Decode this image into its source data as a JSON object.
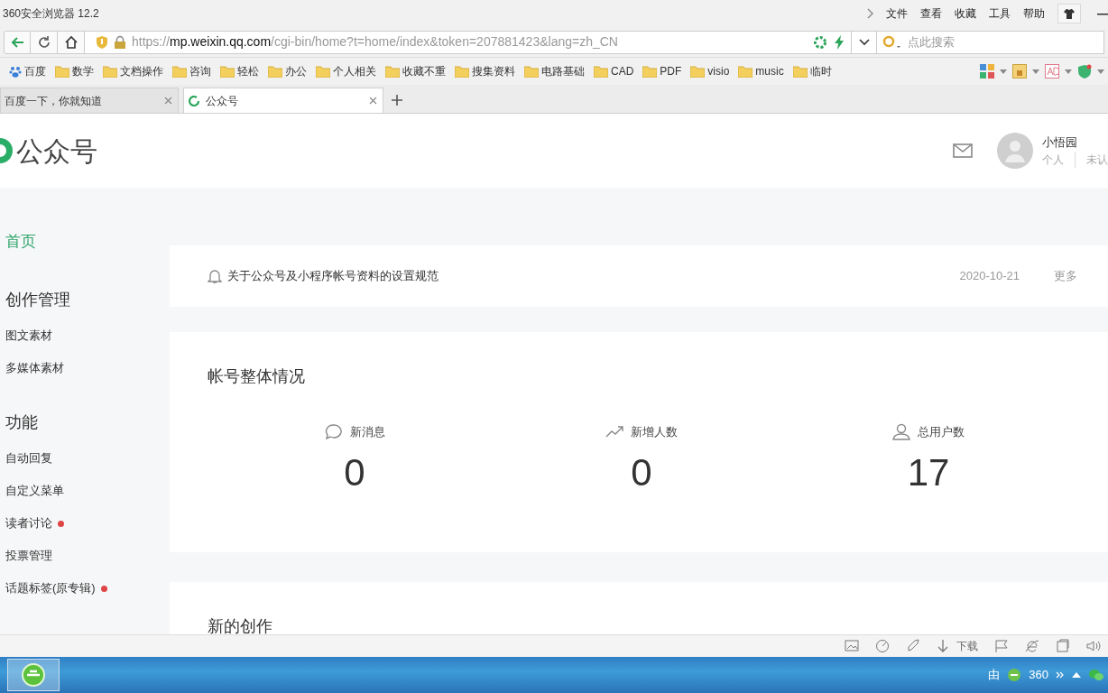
{
  "browser": {
    "title": "360安全浏览器 12.2",
    "menu": [
      "文件",
      "查看",
      "收藏",
      "工具",
      "帮助"
    ],
    "address": {
      "scheme": "https://",
      "domain": "mp.weixin.qq.com",
      "path": "/cgi-bin/home?t=home/index&token=207881423&lang=zh_CN"
    },
    "search": {
      "placeholder": "点此搜索"
    },
    "bookmarks": [
      {
        "label": "百度",
        "kind": "site"
      },
      {
        "label": "数学",
        "kind": "folder"
      },
      {
        "label": "文档操作",
        "kind": "folder"
      },
      {
        "label": "咨询",
        "kind": "folder"
      },
      {
        "label": "轻松",
        "kind": "folder"
      },
      {
        "label": "办公",
        "kind": "folder"
      },
      {
        "label": "个人相关",
        "kind": "folder"
      },
      {
        "label": "收藏不重",
        "kind": "folder"
      },
      {
        "label": "搜集资料",
        "kind": "folder"
      },
      {
        "label": "电路基础",
        "kind": "folder"
      },
      {
        "label": "CAD",
        "kind": "folder"
      },
      {
        "label": "PDF",
        "kind": "folder"
      },
      {
        "label": "visio",
        "kind": "folder"
      },
      {
        "label": "music",
        "kind": "folder"
      },
      {
        "label": "临时",
        "kind": "folder"
      }
    ],
    "tabs": [
      {
        "label": "百度一下，你就知道",
        "selected": false
      },
      {
        "label": "公众号",
        "selected": true
      }
    ],
    "status_bar": {
      "download": "下载"
    }
  },
  "page": {
    "brand": "公众号",
    "user": {
      "name": "小悟园",
      "type": "个人",
      "verify": "未认"
    },
    "sidebar": [
      {
        "kind": "link",
        "label": "首页",
        "selected": true,
        "dot": false
      },
      {
        "kind": "heading",
        "label": "创作管理"
      },
      {
        "kind": "link",
        "label": "图文素材",
        "selected": false,
        "dot": false
      },
      {
        "kind": "link",
        "label": "多媒体素材",
        "selected": false,
        "dot": false
      },
      {
        "kind": "heading",
        "label": "功能"
      },
      {
        "kind": "link",
        "label": "自动回复",
        "selected": false,
        "dot": false
      },
      {
        "kind": "link",
        "label": "自定义菜单",
        "selected": false,
        "dot": false
      },
      {
        "kind": "link",
        "label": "读者讨论",
        "selected": false,
        "dot": true
      },
      {
        "kind": "link",
        "label": "投票管理",
        "selected": false,
        "dot": false
      },
      {
        "kind": "link",
        "label": "话题标签(原专辑)",
        "selected": false,
        "dot": true
      }
    ],
    "notice": {
      "text": "关于公众号及小程序帐号资料的设置规范",
      "date": "2020-10-21",
      "more": "更多"
    },
    "overview": {
      "title": "帐号整体情况",
      "stats": [
        {
          "kind": "message",
          "label": "新消息",
          "value": "0"
        },
        {
          "kind": "growth",
          "label": "新增人数",
          "value": "0"
        },
        {
          "kind": "users",
          "label": "总用户数",
          "value": "17"
        }
      ]
    },
    "creation": {
      "title": "新的创作"
    }
  },
  "taskbar": {
    "ime": "由",
    "tray_label": "360"
  }
}
